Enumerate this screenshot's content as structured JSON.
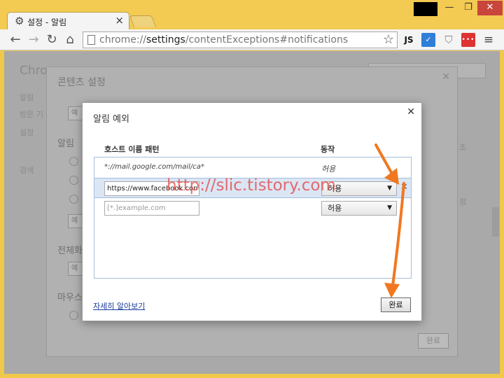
{
  "window": {
    "tab_title": "설정 - 알림",
    "tab_icon": "gear-icon",
    "min_label": "—",
    "max_label": "❐",
    "close_label": "✕"
  },
  "toolbar": {
    "url_prefix": "chrome://",
    "url_host": "settings",
    "url_path": "/contentExceptions#notifications",
    "extensions": [
      "JS",
      "✓",
      "🛡",
      "•••",
      "≡"
    ]
  },
  "background_page": {
    "heading": "Chrom",
    "panel_title": "콘텐츠 설정",
    "section_notifications": "알림",
    "section_fullscreen": "전체화",
    "section_mouse": "마우스",
    "side_labels": [
      "알림",
      "방문 기",
      "설정",
      "검색"
    ],
    "done_label": "완료",
    "btn_label": "예"
  },
  "dialog": {
    "title": "알림 예외",
    "col_host": "호스트 이름 패턴",
    "col_action": "동작",
    "rows": [
      {
        "pattern": "*://mail.google.com/mail/ca*",
        "action": "허용"
      },
      {
        "pattern": "https://www.facebook.com",
        "action": "허용"
      },
      {
        "placeholder": "[*.]example.com",
        "action": "허용"
      }
    ],
    "learn_more": "자세히 알아보기",
    "done": "완료"
  },
  "overlay": {
    "watermark": "http://slic.tistory.com",
    "arrow_color": "#f07820"
  }
}
